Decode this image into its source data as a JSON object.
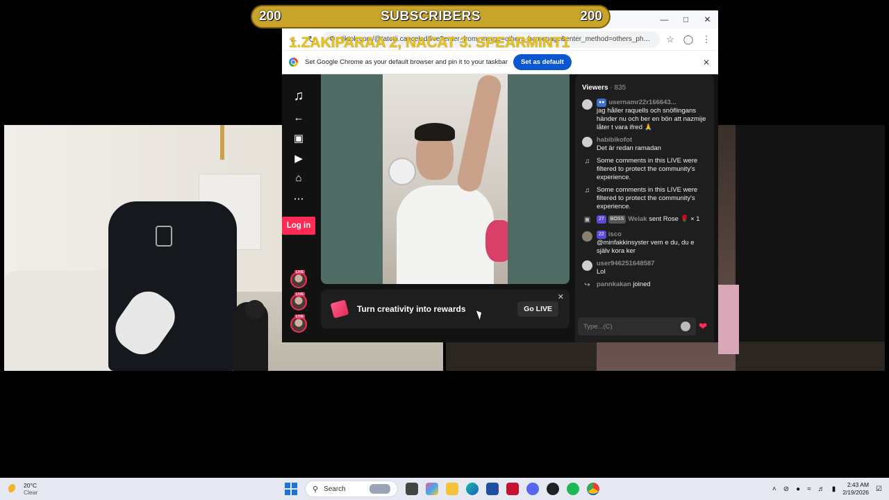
{
  "banner": {
    "left_count": "200",
    "title": "SUBSCRIBERS",
    "right_count": "200"
  },
  "ticker": "1.ZAKIPARAA 2, NACAT 3.  SPEARMINT1",
  "browser": {
    "url": "tiktok.com/@tatotii.canceled/live?enter_from_merge=others_homepage&enter_method=others_photo",
    "infobar_text": "Set Google Chrome as your default browser and pin it to your taskbar",
    "infobar_button": "Set as default"
  },
  "tiktok": {
    "login_label": "Log in",
    "promo_text": "Turn creativity into rewards",
    "promo_button": "Go LIVE",
    "viewers_label": "Viewers",
    "viewers_count": "· 835",
    "chat_placeholder": "Type...(C)",
    "messages": [
      {
        "user": "usernamr22r166643...",
        "text": "jag håller raquells och snöflingans händer nu och ber en bön att nazmije låter t vara ifred 🙏"
      },
      {
        "user": "habibikofot",
        "text": "Det är redan ramadan"
      },
      {
        "user": "",
        "text": "Some comments in this LIVE were filtered to protect the community's experience."
      },
      {
        "user": "",
        "text": "Some comments in this LIVE were filtered to protect the community's experience."
      },
      {
        "badge1": "27",
        "badge2": "BOSS",
        "user": "Welak",
        "text": "sent Rose 🌹 × 1"
      },
      {
        "badge1": "22",
        "user": "isco",
        "text": "@minfakkinsyster vem e du, du e själv kora ker"
      },
      {
        "user": "user946251648587",
        "text": "Lol"
      },
      {
        "user": "pannkakan",
        "text": "joined"
      }
    ]
  },
  "taskbar": {
    "temp": "20°C",
    "condition": "Clear",
    "search_placeholder": "Search",
    "time": "2:43 AM",
    "date": "2/19/2026"
  },
  "colors": {
    "accent": "#fe2c55",
    "banner": "#c9a42a",
    "chrome_button": "#0b57d0"
  }
}
